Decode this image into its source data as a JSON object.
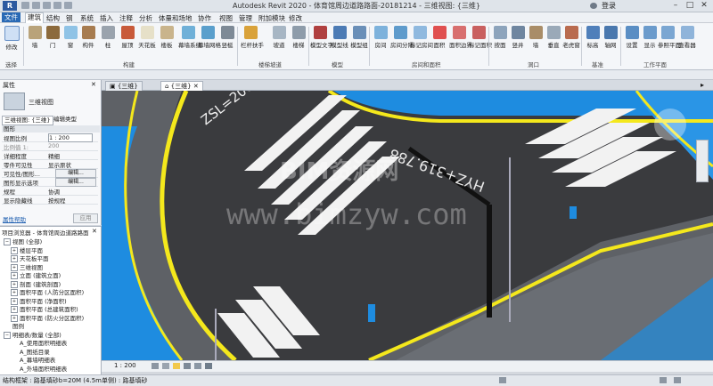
{
  "window": {
    "app_title": "Autodesk Revit 2020 - 体育馆周边道路路面-20181214 - 三维视图: {三维}",
    "login": "登录"
  },
  "menu": {
    "file": "文件",
    "items": [
      "建筑",
      "结构",
      "钢",
      "系统",
      "插入",
      "注释",
      "分析",
      "体量和场地",
      "协作",
      "视图",
      "管理",
      "附加模块",
      "修改"
    ]
  },
  "ribbon": {
    "tools": [
      "修改",
      "墙",
      "门",
      "窗",
      "构件",
      "柱",
      "屋顶",
      "天花板",
      "楼板",
      "幕墙系统",
      "幕墙网格",
      "竖梃",
      "栏杆扶手",
      "坡道",
      "楼梯",
      "模型文字",
      "模型线",
      "模型组",
      "房间",
      "房间分隔",
      "标记房间",
      "面积",
      "面积边界",
      "标记面积",
      "按面",
      "竖井",
      "墙",
      "垂直",
      "老虎窗",
      "标高",
      "轴网",
      "设置",
      "显示",
      "参照平面",
      "查看器"
    ],
    "panels": [
      "选择",
      "构建",
      "楼梯坡道",
      "模型",
      "房间和面积",
      "洞口",
      "基准",
      "工作平面"
    ]
  },
  "properties": {
    "header": "属性",
    "type_name": "三维视图",
    "view_selector": "三维视图: {三维}",
    "edit_type": "编辑类型",
    "group_graphics": "图形",
    "rows": [
      {
        "k": "视图比例",
        "v": "1 : 200"
      },
      {
        "k": "比例值 1:",
        "v": "200"
      },
      {
        "k": "详细程度",
        "v": "精细"
      },
      {
        "k": "零件可见性",
        "v": "显示原状"
      },
      {
        "k": "可见性/图形...",
        "v": "编辑..."
      },
      {
        "k": "图形显示选项",
        "v": "编辑..."
      },
      {
        "k": "规程",
        "v": "协调"
      },
      {
        "k": "显示隐藏线",
        "v": "按规程"
      }
    ],
    "help_link": "属性帮助",
    "apply": "应用"
  },
  "browser": {
    "header": "项目浏览器 - 体育馆周边道路路面...",
    "items": [
      {
        "t": "视图 (全部)",
        "lvl": 0,
        "exp": "−"
      },
      {
        "t": "楼层平面",
        "lvl": 1,
        "exp": "+"
      },
      {
        "t": "天花板平面",
        "lvl": 1,
        "exp": "+"
      },
      {
        "t": "三维视图",
        "lvl": 1,
        "exp": "+"
      },
      {
        "t": "立面 (建筑立面)",
        "lvl": 1,
        "exp": "+"
      },
      {
        "t": "剖面 (建筑剖面)",
        "lvl": 1,
        "exp": "+"
      },
      {
        "t": "面积平面 (人防分区面积)",
        "lvl": 1,
        "exp": "+"
      },
      {
        "t": "面积平面 (净面积)",
        "lvl": 1,
        "exp": "+"
      },
      {
        "t": "面积平面 (总建筑面积)",
        "lvl": 1,
        "exp": "+"
      },
      {
        "t": "面积平面 (防火分区面积)",
        "lvl": 1,
        "exp": "+"
      },
      {
        "t": "图例",
        "lvl": 0,
        "exp": ""
      },
      {
        "t": "明细表/数量 (全部)",
        "lvl": 0,
        "exp": "−"
      },
      {
        "t": "A_使用面积明细表",
        "lvl": 1,
        "exp": ""
      },
      {
        "t": "A_图纸目录",
        "lvl": 1,
        "exp": ""
      },
      {
        "t": "A_幕墙明细表",
        "lvl": 1,
        "exp": ""
      },
      {
        "t": "A_外墙面积明细表",
        "lvl": 1,
        "exp": ""
      }
    ]
  },
  "tabs": [
    {
      "label": "{三维}"
    },
    {
      "label": "{三维}"
    }
  ],
  "viewport": {
    "road_label_1": "ZSL=200",
    "road_label_2": "HYZ+319.788",
    "watermark_cn": "BIM资源网",
    "watermark_url": "www.bimzyw.com",
    "colors": {
      "road": "#3a3b3e",
      "curb_blue": "#1e8ce0",
      "edge_yellow": "#f4e81c",
      "bg": "#5f6368"
    }
  },
  "viewbar": {
    "scale": "1 : 200"
  },
  "status": {
    "text": "结构框架 : 路基填砂b=20M (4.5m单侧) : 路基填砂"
  }
}
